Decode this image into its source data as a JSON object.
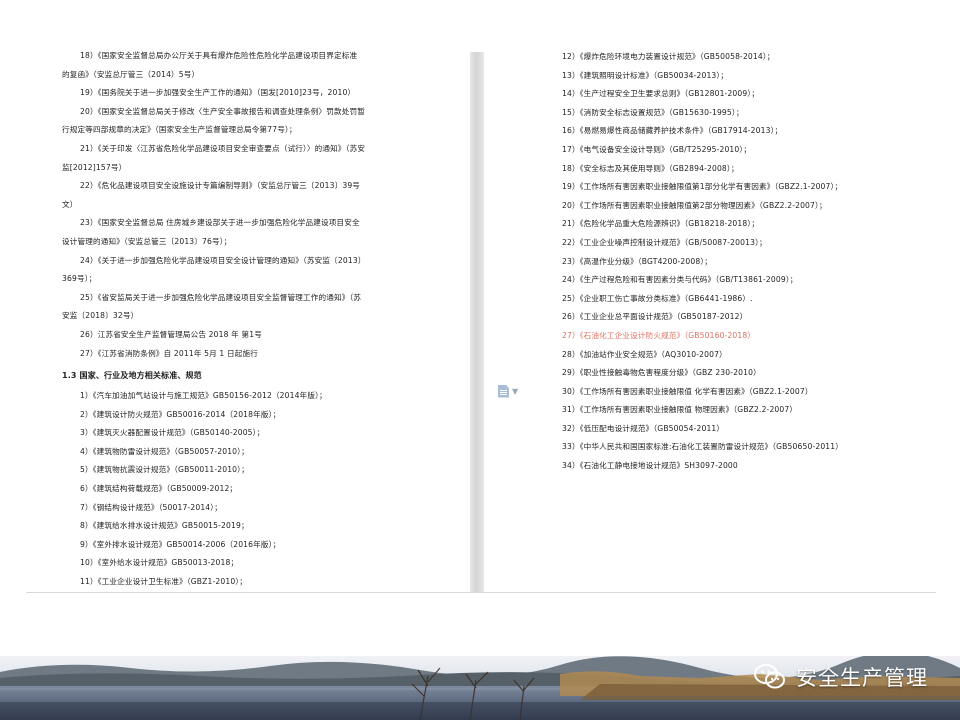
{
  "left_page": {
    "lines": [
      {
        "text": "18）《国家安全监督总局办公厅关于具有爆炸危险性危险化学品建设项目界定标准",
        "kind": "item"
      },
      {
        "text": "的复函》（安监总厅管三（2014）5号）",
        "kind": "cont"
      },
      {
        "text": "19）《国务院关于进一步加强安全生产工作的通知》（国发[2010]23号，2010）",
        "kind": "item"
      },
      {
        "text": "20）《国家安全监督总局关于修改〈生产安全事故报告和调查处理条例〉罚款处罚暂",
        "kind": "item"
      },
      {
        "text": "行规定等四部规章的决定》（国家安全生产监督管理总局令第77号）；",
        "kind": "cont"
      },
      {
        "text": "21）《关于印发〈江苏省危险化学品建设项目安全审查要点（试行）〉的通知》（苏安",
        "kind": "item"
      },
      {
        "text": "监[2012]157号）",
        "kind": "cont"
      },
      {
        "text": "22）《危化品建设项目安全设施设计专篇编制导则》（安监总厅管三〔2013〕39号",
        "kind": "item"
      },
      {
        "text": "文）",
        "kind": "cont"
      },
      {
        "text": "23）《国家安全监督总局 住房城乡建设部关于进一步加强危险化学品建设项目安全",
        "kind": "item"
      },
      {
        "text": "设计管理的通知》（安监总管三〔2013〕76号）；",
        "kind": "cont"
      },
      {
        "text": "24）《关于进一步加强危险化学品建设项目安全设计管理的通知》（苏安监〔2013〕",
        "kind": "item"
      },
      {
        "text": "369号）；",
        "kind": "cont"
      },
      {
        "text": "25）《省安监局关于进一步加强危险化学品建设项目安全监督管理工作的通知》（苏",
        "kind": "item"
      },
      {
        "text": "安监〔2018〕32号）",
        "kind": "cont"
      },
      {
        "text": "26）江苏省安全生产监督管理局公告 2018 年 第1号",
        "kind": "item"
      },
      {
        "text": "27）《江苏省消防条例》自 2011年 5月 1 日起施行",
        "kind": "item"
      },
      {
        "text": "1.3 国家、行业及地方相关标准、规范",
        "kind": "heading"
      },
      {
        "text": "1）《汽车加油加气站设计与施工规范》GB50156-2012（2014年版）；",
        "kind": "item"
      },
      {
        "text": "2）《建筑设计防火规范》GB50016-2014（2018年版）；",
        "kind": "item"
      },
      {
        "text": "3）《建筑灭火器配置设计规范》（GB50140-2005）；",
        "kind": "item"
      },
      {
        "text": "4）《建筑物防雷设计规范》（GB50057-2010）；",
        "kind": "item"
      },
      {
        "text": "5）《建筑物抗震设计规范》（GB50011-2010）；",
        "kind": "item"
      },
      {
        "text": "6）《建筑结构荷载规范》（GB50009-2012；",
        "kind": "item"
      },
      {
        "text": "7）《钢结构设计规范》（50017-2014）；",
        "kind": "item"
      },
      {
        "text": "8）《建筑给水排水设计规范》GB50015-2019；",
        "kind": "item"
      },
      {
        "text": "9）《室外排水设计规范》GB50014-2006（2016年版）；",
        "kind": "item"
      },
      {
        "text": "10）《室外给水设计规范》GB50013-2018；",
        "kind": "item"
      },
      {
        "text": "11）《工业企业设计卫生标准》（GBZ1-2010）；",
        "kind": "item"
      }
    ]
  },
  "right_page": {
    "lines": [
      {
        "text": "12）《爆炸危险环境电力装置设计规范》（GB50058-2014）；",
        "kind": "item"
      },
      {
        "text": "13）《建筑照明设计标准》（GB50034-2013）；",
        "kind": "item"
      },
      {
        "text": "14）《生产过程安全卫生要求总则》（GB12801-2009）；",
        "kind": "item"
      },
      {
        "text": "15）《消防安全标志设置规范》（GB15630-1995）；",
        "kind": "item"
      },
      {
        "text": "16）《易燃易爆性商品储藏养护技术条件》（GB17914-2013）；",
        "kind": "item"
      },
      {
        "text": "17）《电气设备安全设计导则》（GB/T25295-2010）；",
        "kind": "item"
      },
      {
        "text": "18）《安全标志及其使用导则》（GB2894-2008）；",
        "kind": "item"
      },
      {
        "text": "19）《工作场所有害因素职业接触限值第1部分化学有害因素》（GBZ2.1-2007）；",
        "kind": "item"
      },
      {
        "text": "20）《工作场所有害因素职业接触限值第2部分物理因素》（GBZ2.2-2007）；",
        "kind": "item"
      },
      {
        "text": "21）《危险化学品重大危险源辨识》（GB18218-2018）；",
        "kind": "item"
      },
      {
        "text": "22）《工业企业噪声控制设计规范》（GB/50087-20013）；",
        "kind": "item"
      },
      {
        "text": "23）《高温作业分级》（BGT4200-2008）；",
        "kind": "item"
      },
      {
        "text": "24）《生产过程危险和有害因素分类与代码》（GB/T13861-2009）；",
        "kind": "item"
      },
      {
        "text": "25）《企业职工伤亡事故分类标准》（GB6441-1986）.",
        "kind": "item"
      },
      {
        "text": "26）《工业企业总平面设计规范》（GB50187-2012）",
        "kind": "item"
      },
      {
        "text": "27）《石油化工企业设计防火规范》（GB50160-2018）",
        "kind": "highlight"
      },
      {
        "text": "28）《加油站作业安全规范》（AQ3010-2007）",
        "kind": "item"
      },
      {
        "text": "29）《职业性接触毒物危害程度分级》（GBZ 230-2010）",
        "kind": "item"
      },
      {
        "text": "30）《工作场所有害因素职业接触限值 化学有害因素》（GBZ2.1-2007）",
        "kind": "item"
      },
      {
        "text": "31）《工作场所有害因素职业接触限值 物理因素》（GBZ2.2-2007）",
        "kind": "item"
      },
      {
        "text": "32）《低压配电设计规范》（GB50054-2011）",
        "kind": "item"
      },
      {
        "text": "33）《中华人民共和国国家标准:石油化工装置防雷设计规范》（GB50650-2011）",
        "kind": "item"
      },
      {
        "text": "34）《石油化工静电接地设计规范》SH3097-2000",
        "kind": "item"
      }
    ]
  },
  "watermark": {
    "text": "安全生产管理",
    "icon": "wechat-icon"
  },
  "icons": {
    "doc": "document-icon",
    "caret": "chevron-down-icon"
  },
  "colors": {
    "text": "#222222",
    "highlight": "#e07060",
    "gutter": "#d6d6d6"
  }
}
